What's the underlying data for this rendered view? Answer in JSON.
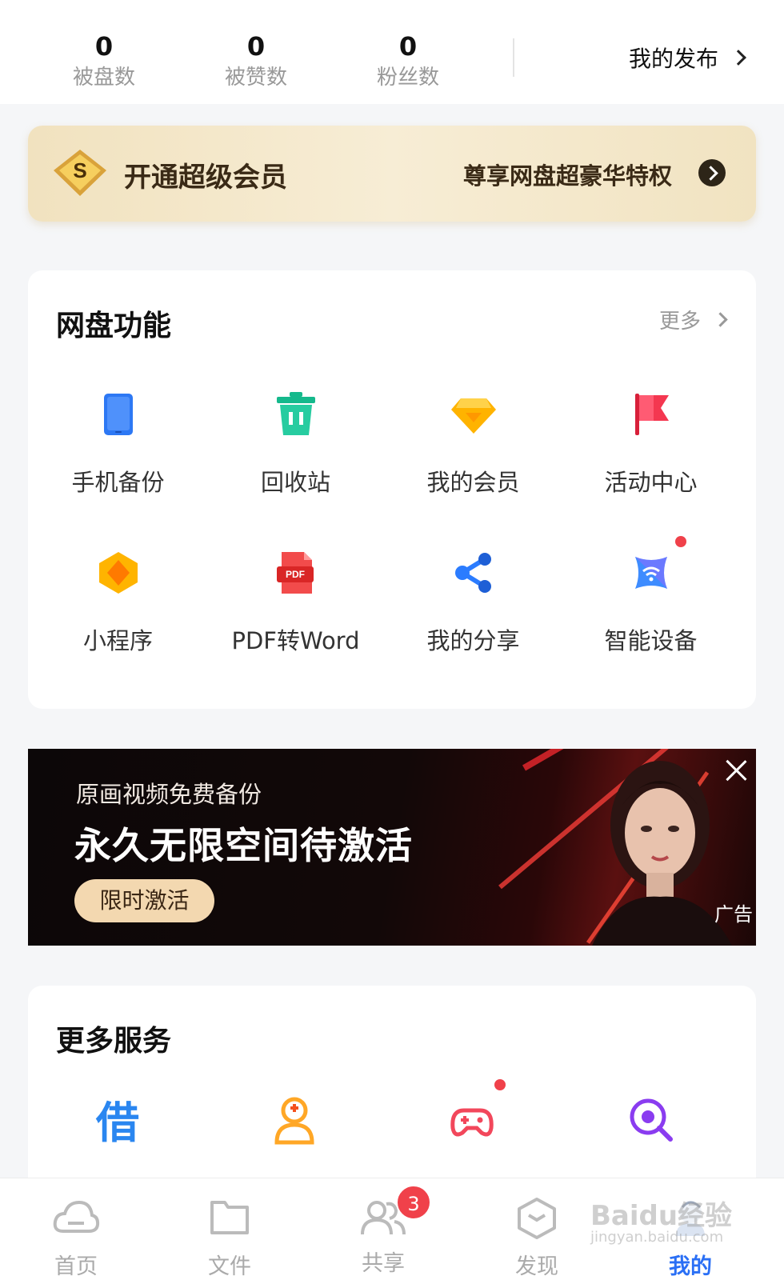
{
  "stats": [
    {
      "value": "0",
      "label": "被盘数"
    },
    {
      "value": "0",
      "label": "被赞数"
    },
    {
      "value": "0",
      "label": "粉丝数"
    }
  ],
  "my_publish": "我的发布",
  "vip": {
    "badge_letter": "S",
    "title": "开通超级会员",
    "subtitle": "尊享网盘超豪华特权",
    "colors": {
      "bg": "#f3e6c8",
      "text": "#3a2a16"
    }
  },
  "functions": {
    "title": "网盘功能",
    "more": "更多",
    "items": [
      {
        "label": "手机备份",
        "icon": "phone-icon"
      },
      {
        "label": "回收站",
        "icon": "trash-icon"
      },
      {
        "label": "我的会员",
        "icon": "gem-icon"
      },
      {
        "label": "活动中心",
        "icon": "flag-icon"
      },
      {
        "label": "小程序",
        "icon": "mini-program-icon"
      },
      {
        "label": "PDF转Word",
        "icon": "pdf-icon",
        "icon_text": "PDF"
      },
      {
        "label": "我的分享",
        "icon": "share-icon"
      },
      {
        "label": "智能设备",
        "icon": "smart-device-icon"
      }
    ]
  },
  "ad": {
    "line1": "原画视频免费备份",
    "line2": "永久无限空间待激活",
    "button": "限时激活",
    "tag": "广告"
  },
  "services": {
    "title": "更多服务",
    "items": [
      {
        "icon": "borrow-icon",
        "glyph": "借"
      },
      {
        "icon": "user-service-icon"
      },
      {
        "icon": "gamepad-icon"
      },
      {
        "icon": "search-lens-icon"
      }
    ]
  },
  "nav": [
    {
      "label": "首页",
      "icon": "cloud-icon"
    },
    {
      "label": "文件",
      "icon": "folder-icon"
    },
    {
      "label": "共享",
      "icon": "people-icon",
      "badge": "3"
    },
    {
      "label": "发现",
      "icon": "discover-icon"
    },
    {
      "label": "我的",
      "icon": "profile-icon",
      "active": true
    }
  ],
  "watermark": {
    "line1": "Baidu经验",
    "line2": "jingyan.baidu.com"
  },
  "accent": "#2a6ff5"
}
